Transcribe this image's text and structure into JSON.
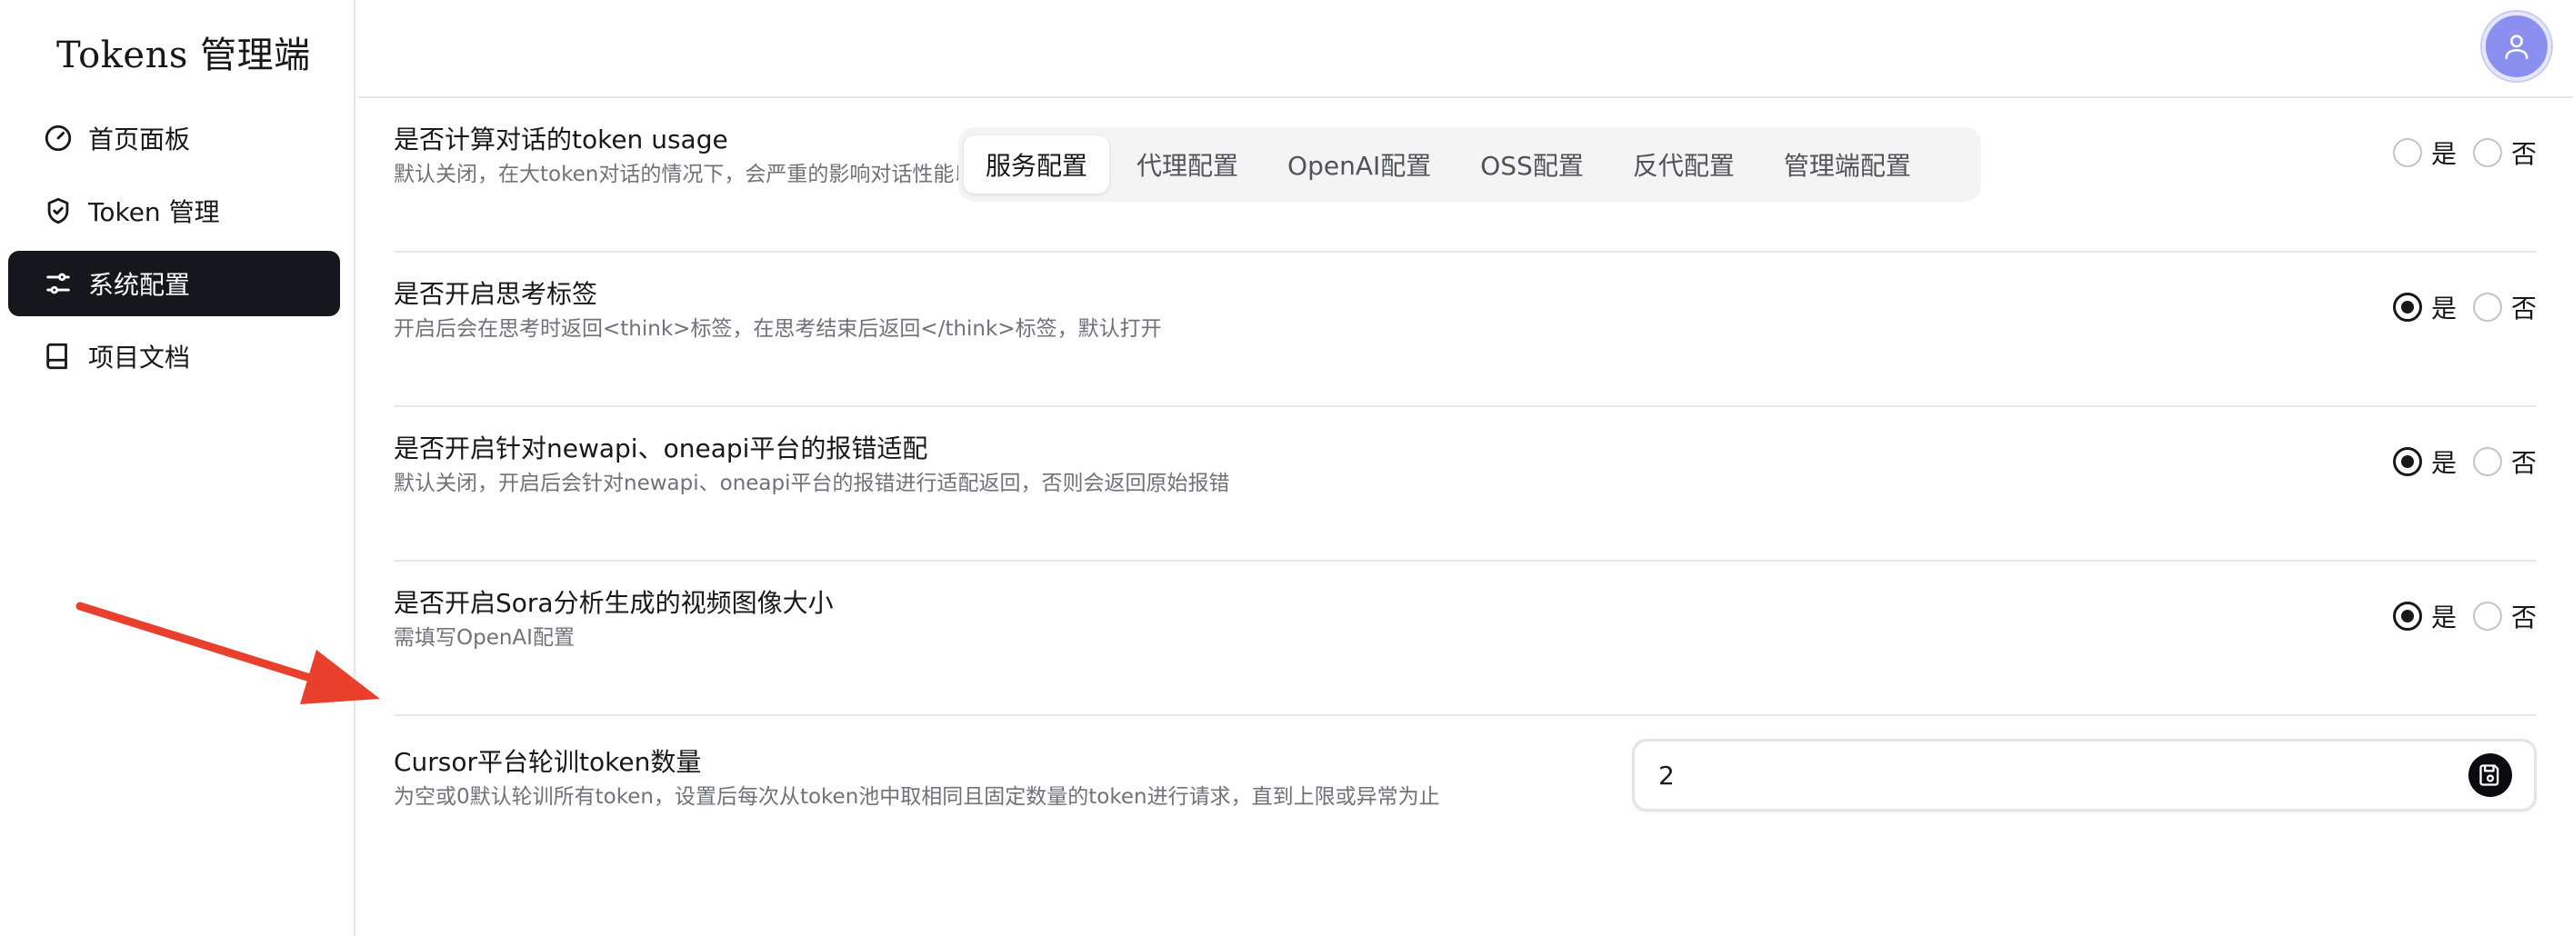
{
  "app": {
    "brand": "Tokens 管理端"
  },
  "sidebar": {
    "items": [
      {
        "label": "首页面板",
        "icon": "gauge-icon",
        "active": false
      },
      {
        "label": "Token 管理",
        "icon": "shield-check-icon",
        "active": false
      },
      {
        "label": "系统配置",
        "icon": "sliders-icon",
        "active": true
      },
      {
        "label": "项目文档",
        "icon": "book-icon",
        "active": false
      }
    ]
  },
  "header": {
    "avatar_icon": "user-icon",
    "avatar_color": "#8b8ff0"
  },
  "tabs": [
    {
      "label": "服务配置",
      "active": true
    },
    {
      "label": "代理配置",
      "active": false
    },
    {
      "label": "OpenAI配置",
      "active": false
    },
    {
      "label": "OSS配置",
      "active": false
    },
    {
      "label": "反代配置",
      "active": false
    },
    {
      "label": "管理端配置",
      "active": false
    }
  ],
  "settings": [
    {
      "title": "是否计算对话的token usage",
      "desc": "默认关闭，在大token对话的情况下，会严重的影响对话性能以及导致系统CPU的飙升",
      "yes": "是",
      "no": "否",
      "value": null
    },
    {
      "title": "是否开启思考标签",
      "desc": "开启后会在思考时返回<think>标签，在思考结束后返回</think>标签，默认打开",
      "yes": "是",
      "no": "否",
      "value": "yes"
    },
    {
      "title": "是否开启针对newapi、oneapi平台的报错适配",
      "desc": "默认关闭，开启后会针对newapi、oneapi平台的报错进行适配返回，否则会返回原始报错",
      "yes": "是",
      "no": "否",
      "value": "yes"
    },
    {
      "title": "是否开启Sora分析生成的视频图像大小",
      "desc": "需填写OpenAI配置",
      "yes": "是",
      "no": "否",
      "value": "yes"
    }
  ],
  "rotation": {
    "title": "Cursor平台轮训token数量",
    "desc": "为空或0默认轮训所有token，设置后每次从token池中取相同且固定数量的token进行请求，直到上限或异常为止",
    "value": "2",
    "save_icon": "save-icon"
  },
  "annotation": {
    "arrow_color": "#e8402c"
  }
}
